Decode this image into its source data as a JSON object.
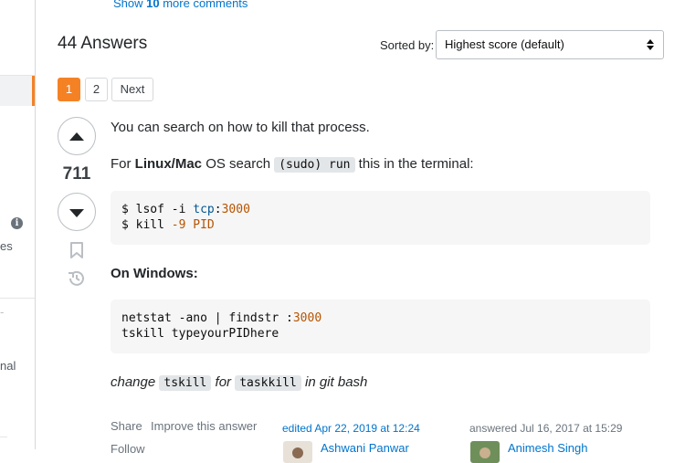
{
  "header": {
    "show_more_prefix": "Show ",
    "show_more_count": "10",
    "show_more_suffix": " more comments",
    "answers_title": "44 Answers",
    "sorted_by_label": "Sorted by:",
    "sort_value": "Highest score (default)"
  },
  "pagination": {
    "pages": [
      "1",
      "2"
    ],
    "next": "Next",
    "current": "1"
  },
  "sidebar": {
    "text_1": "es",
    "text_2": "-",
    "text_3": "nal",
    "info_icon": "i"
  },
  "answer": {
    "score": "711",
    "intro": "You can search on how to kill that process.",
    "line2_pre": "For ",
    "line2_bold": "Linux/Mac",
    "line2_mid": " OS search ",
    "line2_code": "(sudo) run",
    "line2_post": " this in the terminal:",
    "code1": {
      "l1_cmd": "$ lsof -i ",
      "l1_kw": "tcp",
      "l1_colon": ":",
      "l1_num": "3000",
      "l2_cmd": "$ kill ",
      "l2_num": "-9",
      "l2_tail": " PID"
    },
    "windows_heading": "On Windows:",
    "code2": {
      "l1_cmd": "netstat -ano | findstr :",
      "l1_num": "3000",
      "l2_cmd": "tskill typeyourPIDhere"
    },
    "change_pre": "change ",
    "change_code1": "tskill",
    "change_mid": " for ",
    "change_code2": "taskkill",
    "change_post": " in git bash"
  },
  "footer": {
    "share": "Share",
    "improve": "Improve this answer",
    "follow": "Follow",
    "edited": "edited Apr 22, 2019 at 12:24",
    "answered": "answered Jul 16, 2017 at 15:29",
    "editor_name": "Ashwani Panwar",
    "author_name": "Animesh Singh"
  },
  "colors": {
    "accent": "#f48225",
    "link": "#0074cc",
    "code_bg": "#f6f6f6"
  }
}
